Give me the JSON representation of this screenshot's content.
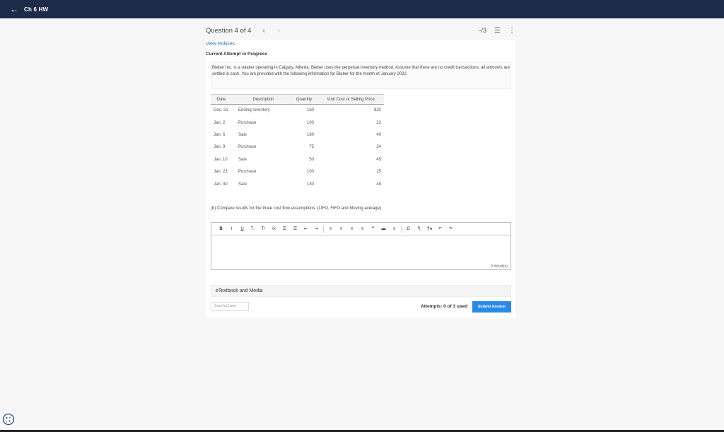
{
  "topbar": {
    "back_icon": "arrow-left-icon",
    "title": "Ch 6 HW"
  },
  "question_header": {
    "title": "Question 4 of 4",
    "prev": "‹",
    "next": "›",
    "score": "-/3",
    "list_icon": "☰",
    "more_icon": "⋮"
  },
  "policies_link": "View Policies",
  "attempt_status": "Current Attempt in Progress",
  "problem_text": "Bieber Inc. is a retailer operating in Calgary, Alberta. Bieber uses the perpetual inventory method. Assume that there are no credit transactions; all amounts are settled in cash. You are provided with the following information for Bieber for the month of January 2022.",
  "table": {
    "headers": [
      "Date",
      "Description",
      "Quantity",
      "Unit Cost or Selling Price"
    ],
    "rows": [
      [
        "Dec. 31",
        "Ending inventory",
        "160",
        "$20"
      ],
      [
        "Jan. 2",
        "Purchase",
        "100",
        "22"
      ],
      [
        "Jan. 6",
        "Sale",
        "180",
        "40"
      ],
      [
        "Jan. 9",
        "Purchase",
        "75",
        "24"
      ],
      [
        "Jan. 10",
        "Sale",
        "50",
        "45"
      ],
      [
        "Jan. 23",
        "Purchase",
        "100",
        "25"
      ],
      [
        "Jan. 30",
        "Sale",
        "130",
        "48"
      ]
    ]
  },
  "part_b": "(b) Compare results for the three cost flow assumptions. (LIFO, FIFO and Moving average)",
  "toolbar": [
    "B",
    "I",
    "U",
    "T₁",
    "T¹",
    "Ix",
    "☰",
    "☰",
    "⇤",
    "⇥",
    "≡",
    "≡",
    "≡",
    "≡",
    "❞",
    "▬",
    "≡",
    "Ω",
    "¶",
    "¶◂",
    "↶",
    "↷"
  ],
  "word_count": "0 Word(s)",
  "etextbook": "eTextbook and Media",
  "save_label": "Save for Later",
  "attempts": "Attempts: 0 of 3 used",
  "submit_label": "Submit Answer",
  "colors": {
    "topbar": "#1c2b4a",
    "accent": "#2a8ae8",
    "link": "#2d6fb7"
  }
}
